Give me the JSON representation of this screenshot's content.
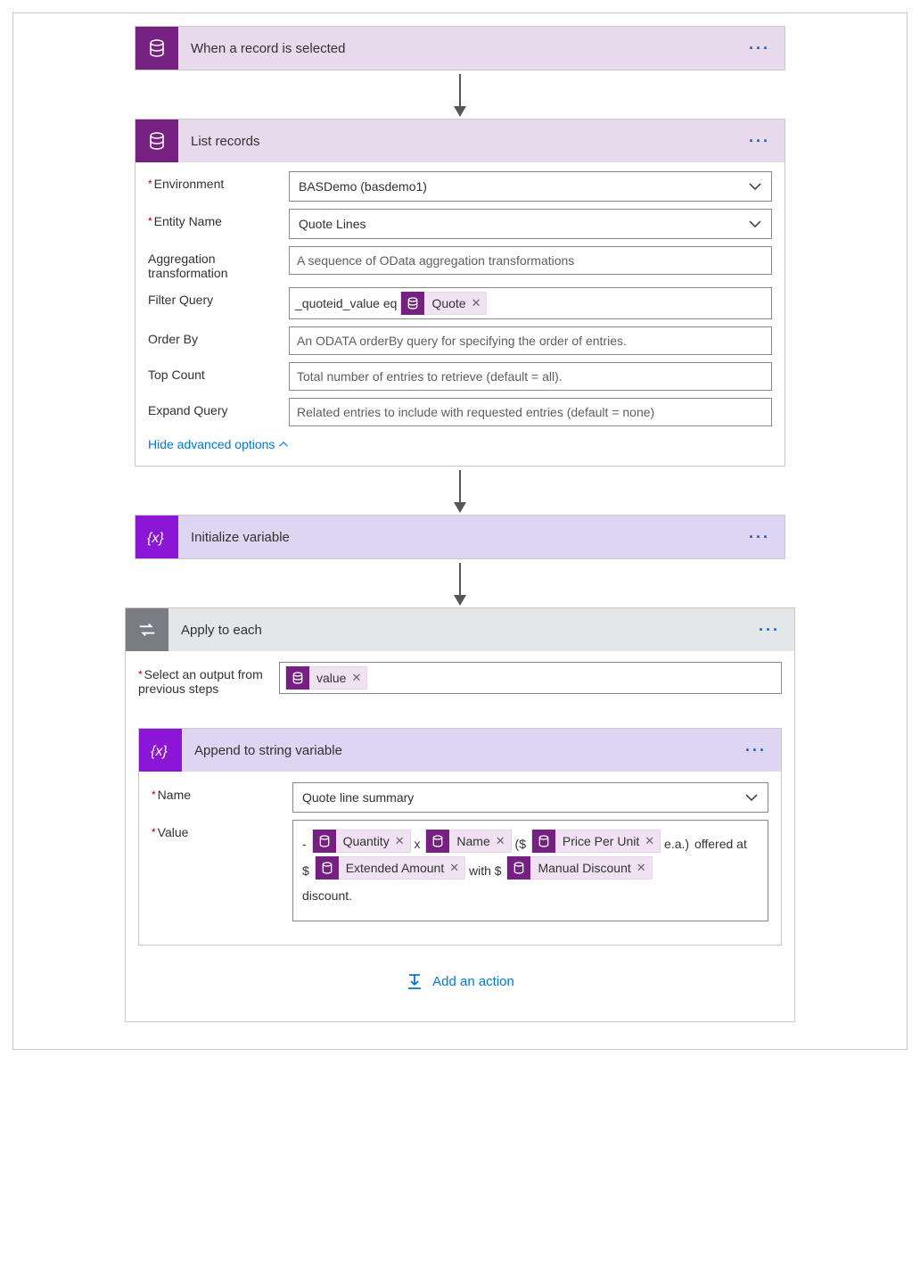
{
  "steps": {
    "trigger": {
      "title": "When a record is selected"
    },
    "list_records": {
      "title": "List records",
      "fields": {
        "environment": {
          "label": "Environment",
          "value": "BASDemo (basdemo1)"
        },
        "entity_name": {
          "label": "Entity Name",
          "value": "Quote Lines"
        },
        "aggregation": {
          "label": "Aggregation transformation",
          "placeholder": "A sequence of OData aggregation transformations"
        },
        "filter_query": {
          "label": "Filter Query",
          "prefix": "_quoteid_value eq",
          "token": "Quote"
        },
        "order_by": {
          "label": "Order By",
          "placeholder": "An ODATA orderBy query for specifying the order of entries."
        },
        "top_count": {
          "label": "Top Count",
          "placeholder": "Total number of entries to retrieve (default = all)."
        },
        "expand_query": {
          "label": "Expand Query",
          "placeholder": "Related entries to include with requested entries (default = none)"
        }
      },
      "hide_advanced": "Hide advanced options"
    },
    "init_var": {
      "title": "Initialize variable"
    },
    "apply_each": {
      "title": "Apply to each",
      "select_output_label": "Select an output from previous steps",
      "select_output_token": "value",
      "append": {
        "title": "Append to string variable",
        "name_label": "Name",
        "name_value": "Quote line summary",
        "value_label": "Value",
        "value_parts": {
          "dash": "-",
          "t1": "Quantity",
          "x": "x",
          "t2": "Name",
          "open": "($",
          "t3": "Price Per Unit",
          "ea": "e.a.)",
          "offered": "offered at $",
          "t4": "Extended Amount",
          "with": "with $",
          "t5": "Manual Discount",
          "disc": "discount."
        }
      }
    }
  },
  "add_action": "Add an action"
}
